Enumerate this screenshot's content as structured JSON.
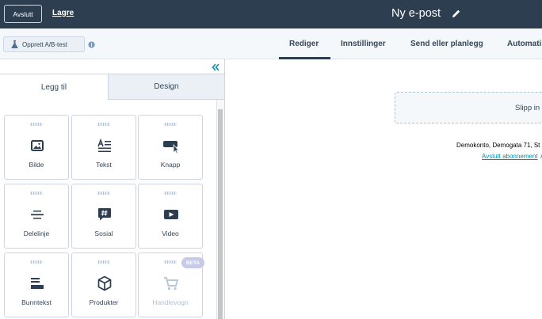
{
  "topbar": {
    "exit_label": "Avslutt",
    "save_label": "Lagre",
    "title": "Ny e-post",
    "edit_icon": "pencil-icon"
  },
  "subbar": {
    "ab_test_label": "Opprett A/B-test",
    "info_icon": "info-icon",
    "tabs": [
      {
        "label": "Rediger",
        "active": true
      },
      {
        "label": "Innstillinger",
        "active": false
      },
      {
        "label": "Send eller planlegg",
        "active": false
      },
      {
        "label": "Automati",
        "active": false
      }
    ]
  },
  "sidebar": {
    "collapse_icon": "double-chevron-left-icon",
    "panel_tabs": [
      {
        "label": "Legg til",
        "active": true
      },
      {
        "label": "Design",
        "active": false
      }
    ],
    "modules": [
      {
        "label": "Bilde",
        "icon": "image-icon",
        "enabled": true
      },
      {
        "label": "Tekst",
        "icon": "text-icon",
        "enabled": true
      },
      {
        "label": "Knapp",
        "icon": "button-cursor-icon",
        "enabled": true
      },
      {
        "label": "Delelinje",
        "icon": "divider-icon",
        "enabled": true
      },
      {
        "label": "Sosial",
        "icon": "social-hashtag-icon",
        "enabled": true
      },
      {
        "label": "Video",
        "icon": "video-icon",
        "enabled": true
      },
      {
        "label": "Bunntekst",
        "icon": "footer-icon",
        "enabled": true
      },
      {
        "label": "Produkter",
        "icon": "product-box-icon",
        "enabled": true
      },
      {
        "label": "Handlevogn",
        "icon": "cart-icon",
        "enabled": false,
        "badge": "BETA"
      }
    ]
  },
  "canvas": {
    "dropzone_text": "Slipp in",
    "footer_address": "Demokonto, Demogata 71, St",
    "unsubscribe_link": "Avslutt abonnement",
    "second_link": "A"
  },
  "colors": {
    "topbar_bg": "#2d3e50",
    "subbar_bg": "#f5f8fa",
    "link": "#0091ae",
    "beta_badge": "#c7cbe8"
  }
}
